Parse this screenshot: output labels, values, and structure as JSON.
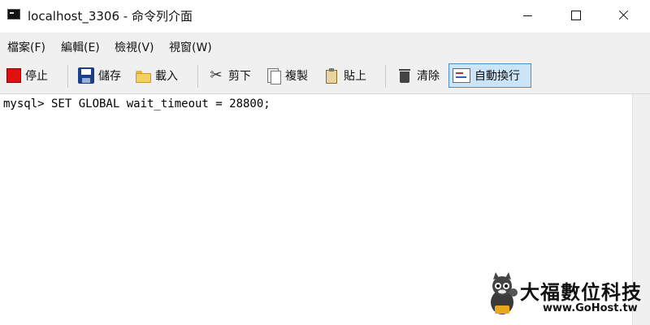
{
  "window": {
    "title": "localhost_3306 - 命令列介面",
    "controls": {
      "minimize": "minimize-icon",
      "maximize": "maximize-icon",
      "close": "close-icon"
    }
  },
  "menu": {
    "items": [
      {
        "label": "檔案(F)"
      },
      {
        "label": "編輯(E)"
      },
      {
        "label": "檢視(V)"
      },
      {
        "label": "視窗(W)"
      }
    ]
  },
  "toolbar": {
    "stop": {
      "label": "停止",
      "icon": "stop-icon"
    },
    "save": {
      "label": "儲存",
      "icon": "save-icon"
    },
    "load": {
      "label": "載入",
      "icon": "folder-icon"
    },
    "cut": {
      "label": "剪下",
      "icon": "scissors-icon"
    },
    "copy": {
      "label": "複製",
      "icon": "copy-icon"
    },
    "paste": {
      "label": "貼上",
      "icon": "clipboard-icon"
    },
    "clear": {
      "label": "清除",
      "icon": "trash-icon"
    },
    "wrap": {
      "label": "自動換行",
      "icon": "word-wrap-icon",
      "active": true
    }
  },
  "console": {
    "lines": [
      "mysql> SET GLOBAL wait_timeout = 28800;"
    ]
  },
  "watermark": {
    "name": "大福數位科技",
    "url": "www.GoHost.tw"
  },
  "colors": {
    "toolbar_bg": "#f0f0f0",
    "active_button_bg": "#cce4f7",
    "active_button_border": "#4a90d0",
    "stop_red": "#e01010"
  }
}
